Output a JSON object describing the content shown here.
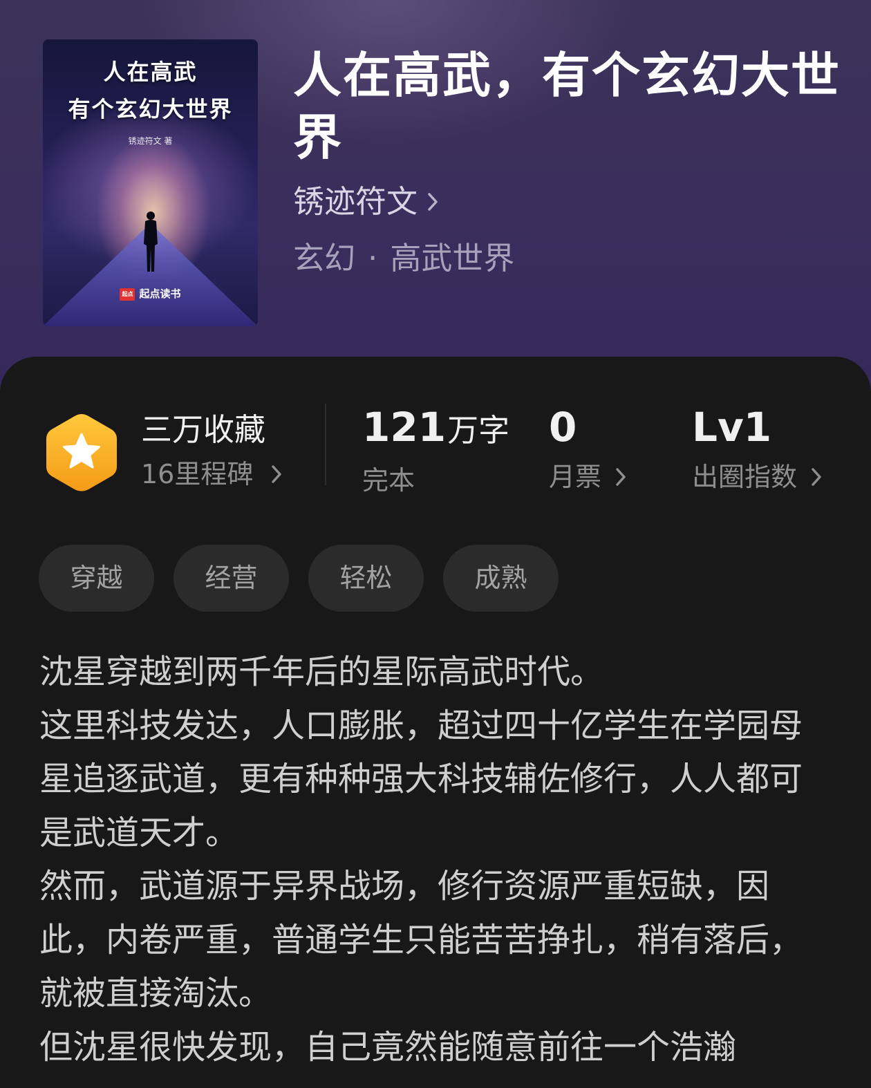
{
  "book": {
    "title": "人在高武，有个玄幻大世界",
    "author": "锈迹符文",
    "genre": "玄幻",
    "subgenre": "高武世界",
    "genre_separator": "·"
  },
  "cover": {
    "title_line1": "人在高武",
    "title_line2": "有个玄幻大世界",
    "author_credit": "锈迹符文 著",
    "publisher": "起点读书",
    "publisher_logo": "起点"
  },
  "stats": {
    "collection_title": "三万收藏",
    "milestones": "16里程碑",
    "word_count_value": "121",
    "word_count_unit": "万字",
    "word_count_label": "完本",
    "monthly_votes_value": "0",
    "monthly_votes_label": "月票",
    "level_value": "Lv1",
    "level_label": "出圈指数"
  },
  "tags": [
    "穿越",
    "经营",
    "轻松",
    "成熟"
  ],
  "description": [
    "沈星穿越到两千年后的星际高武时代。",
    "这里科技发达，人口膨胀，超过四十亿学生在学园母星追逐武道，更有种种强大科技辅佐修行，人人都可是武道天才。",
    "然而，武道源于异界战场，修行资源严重短缺，因此，内卷严重，普通学生只能苦苦挣扎，稍有落后，就被直接淘汰。",
    "但沈星很快发现，自己竟然能随意前往一个浩瀚"
  ],
  "colors": {
    "header_bg": "#3a2f5c",
    "panel_bg": "#181818",
    "badge": "#f5a623",
    "tag_bg": "#2b2b2b"
  },
  "icons": {
    "badge": "hexagon-star-icon",
    "chevron": "chevron-right-icon"
  }
}
